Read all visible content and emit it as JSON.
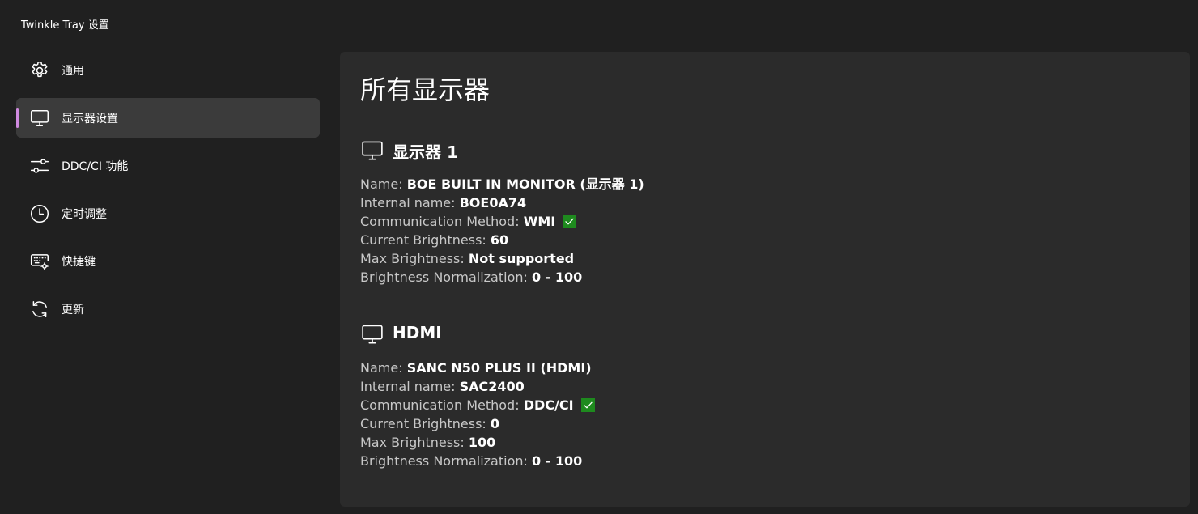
{
  "window": {
    "title": "Twinkle Tray 设置"
  },
  "sidebar": {
    "items": [
      {
        "label": "通用",
        "icon": "gear-icon",
        "active": false
      },
      {
        "label": "显示器设置",
        "icon": "monitor-icon",
        "active": true
      },
      {
        "label": "DDC/CI 功能",
        "icon": "sliders-icon",
        "active": false
      },
      {
        "label": "定时调整",
        "icon": "clock-icon",
        "active": false
      },
      {
        "label": "快捷键",
        "icon": "keyboard-icon",
        "active": false
      },
      {
        "label": "更新",
        "icon": "refresh-icon",
        "active": false
      }
    ]
  },
  "main": {
    "title": "所有显示器",
    "monitors": [
      {
        "title": "显示器 1",
        "name_label": "Name:",
        "name_value": "BOE BUILT IN MONITOR (显示器 1)",
        "internal_label": "Internal name:",
        "internal_value": "BOE0A74",
        "comm_label": "Communication Method:",
        "comm_value": "WMI",
        "current_label": "Current Brightness:",
        "current_value": "60",
        "max_label": "Max Brightness:",
        "max_value": "Not supported",
        "norm_label": "Brightness Normalization:",
        "norm_value": "0 - 100"
      },
      {
        "title": "HDMI",
        "name_label": "Name:",
        "name_value": "SANC N50 PLUS II (HDMI)",
        "internal_label": "Internal name:",
        "internal_value": "SAC2400",
        "comm_label": "Communication Method:",
        "comm_value": "DDC/CI",
        "current_label": "Current Brightness:",
        "current_value": "0",
        "max_label": "Max Brightness:",
        "max_value": "100",
        "norm_label": "Brightness Normalization:",
        "norm_value": "0 - 100"
      }
    ]
  },
  "colors": {
    "background": "#202020",
    "panel": "#2b2b2b",
    "active_item": "#3b3b3b",
    "accent": "#d08ae0",
    "check": "#1e8a1e"
  }
}
